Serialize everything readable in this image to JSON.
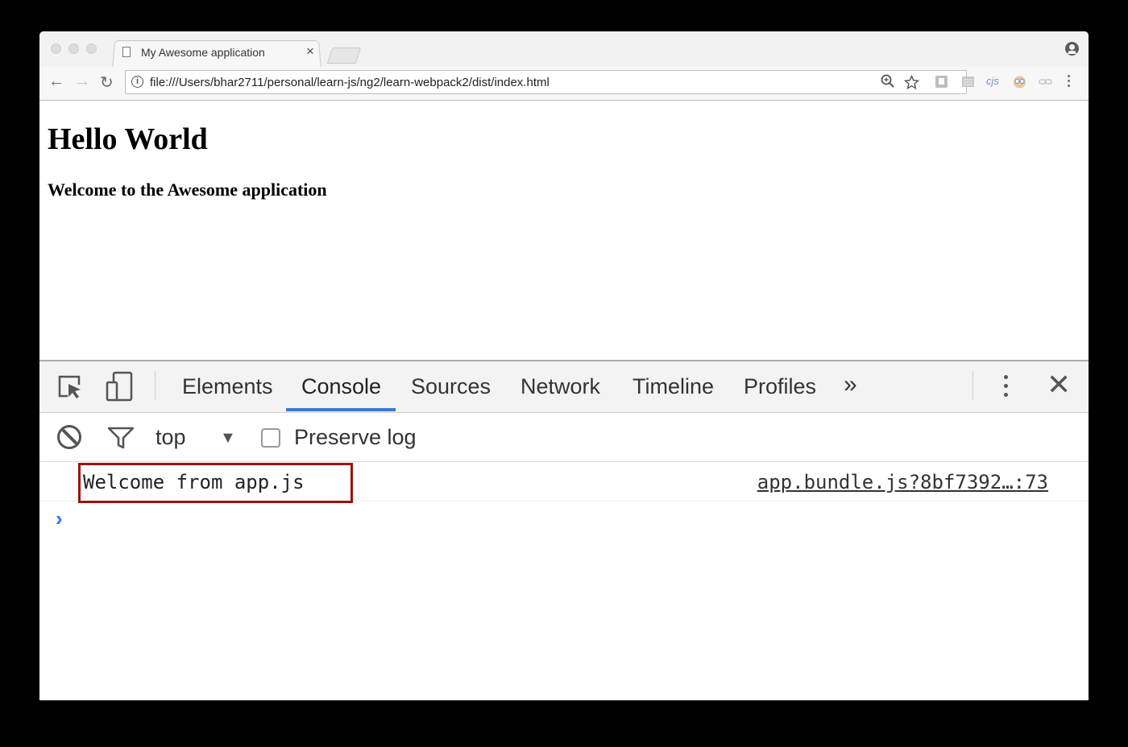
{
  "browser": {
    "tab_title": "My Awesome application",
    "tab_close": "×",
    "url": "file:///Users/bhar2711/personal/learn-js/ng2/learn-webpack2/dist/index.html",
    "extensions": [
      "ext-square-icon",
      "ext-list-icon",
      "cjs",
      "ext-owl-icon",
      "ext-link-icon"
    ]
  },
  "page": {
    "heading": "Hello World",
    "subheading": "Welcome to the Awesome application"
  },
  "devtools": {
    "tabs": [
      "Elements",
      "Console",
      "Sources",
      "Network",
      "Timeline",
      "Profiles"
    ],
    "active_tab": "Console",
    "more_label": "»",
    "context": "top",
    "preserve_log_label": "Preserve log",
    "preserve_log_checked": false,
    "console": {
      "message": "Welcome from app.js",
      "source": "app.bundle.js?8bf7392…:73",
      "prompt": "›"
    },
    "colors": {
      "accent": "#3879d9",
      "highlight_border": "#a01010"
    }
  }
}
